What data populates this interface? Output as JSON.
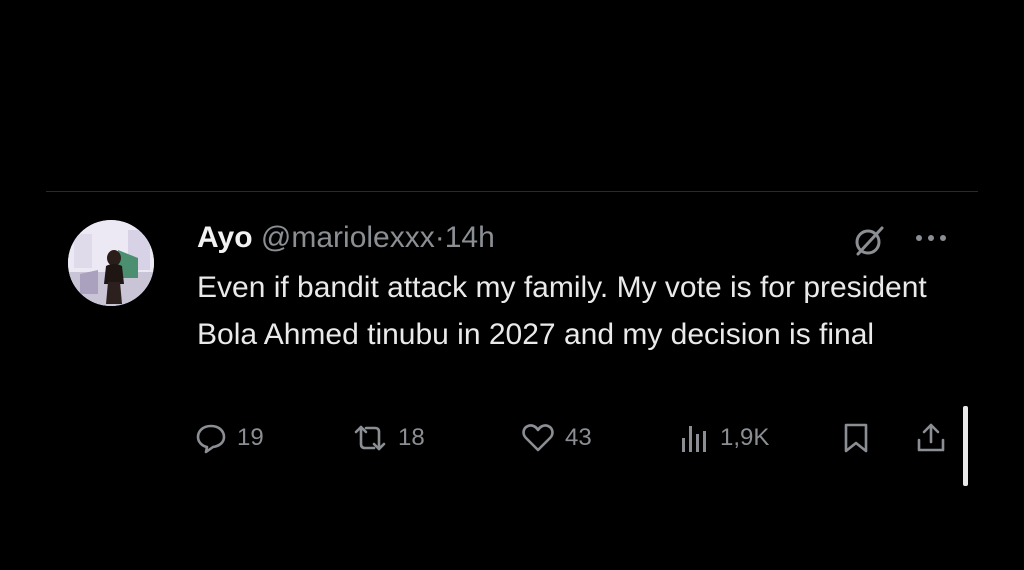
{
  "tweet": {
    "author_name": "Ayo",
    "handle": "@mariolexxx",
    "separator": "·",
    "time": "14h",
    "text": "Even if bandit attack my family. My vote is for president Bola Ahmed tinubu in 2027 and my decision is final",
    "avatar_icon": "profile-photo"
  },
  "actions": {
    "replies": "19",
    "reposts": "18",
    "likes": "43",
    "views": "1,9K"
  },
  "icons": {
    "reply": "reply-icon",
    "repost": "repost-icon",
    "like": "like-icon",
    "views": "views-icon",
    "bookmark": "bookmark-icon",
    "share": "share-icon",
    "grok": "grok-icon",
    "more": "more-icon"
  },
  "colors": {
    "background": "#000000",
    "text_primary": "#e7e9ea",
    "text_secondary": "#8b8f94",
    "divider": "#2a2a2a"
  }
}
